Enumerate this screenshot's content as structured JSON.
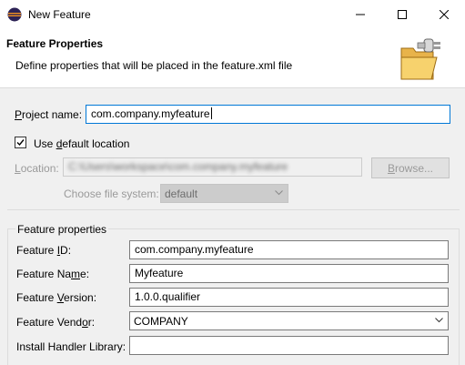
{
  "window": {
    "title": "New Feature",
    "controls": [
      "minimize",
      "maximize",
      "close"
    ]
  },
  "header": {
    "title": "Feature Properties",
    "description": "Define properties that will be placed in the feature.xml file",
    "icon": "folder-plug-icon"
  },
  "project": {
    "label_prefix": "",
    "label_mnemonic": "P",
    "label_rest": "roject name:",
    "value": "com.company.myfeature"
  },
  "location": {
    "default_checkbox_prefix": "Use ",
    "default_checkbox_mnemonic": "d",
    "default_checkbox_rest": "efault location",
    "default_checked": true,
    "label_mnemonic": "L",
    "label_rest": "ocation:",
    "value": "C:\\Users\\workspace\\com.company.myfeature",
    "browse_label_mnemonic": "B",
    "browse_label_rest": "rowse...",
    "file_system_label": "Choose file system:",
    "file_system_value": "default"
  },
  "feature_properties": {
    "group_title": "Feature properties",
    "fields": [
      {
        "label_prefix": "Feature ",
        "label_mnemonic": "I",
        "label_rest": "D:",
        "value": "com.company.myfeature"
      },
      {
        "label_prefix": "Feature Na",
        "label_mnemonic": "m",
        "label_rest": "e:",
        "value": "Myfeature"
      },
      {
        "label_prefix": "Feature ",
        "label_mnemonic": "V",
        "label_rest": "ersion:",
        "value": "1.0.0.qualifier"
      },
      {
        "label_prefix": "Feature Vend",
        "label_mnemonic": "o",
        "label_rest": "r:",
        "value": "COMPANY"
      },
      {
        "label_prefix": "Install Handler Library:",
        "label_mnemonic": "",
        "label_rest": "",
        "value": ""
      }
    ]
  }
}
